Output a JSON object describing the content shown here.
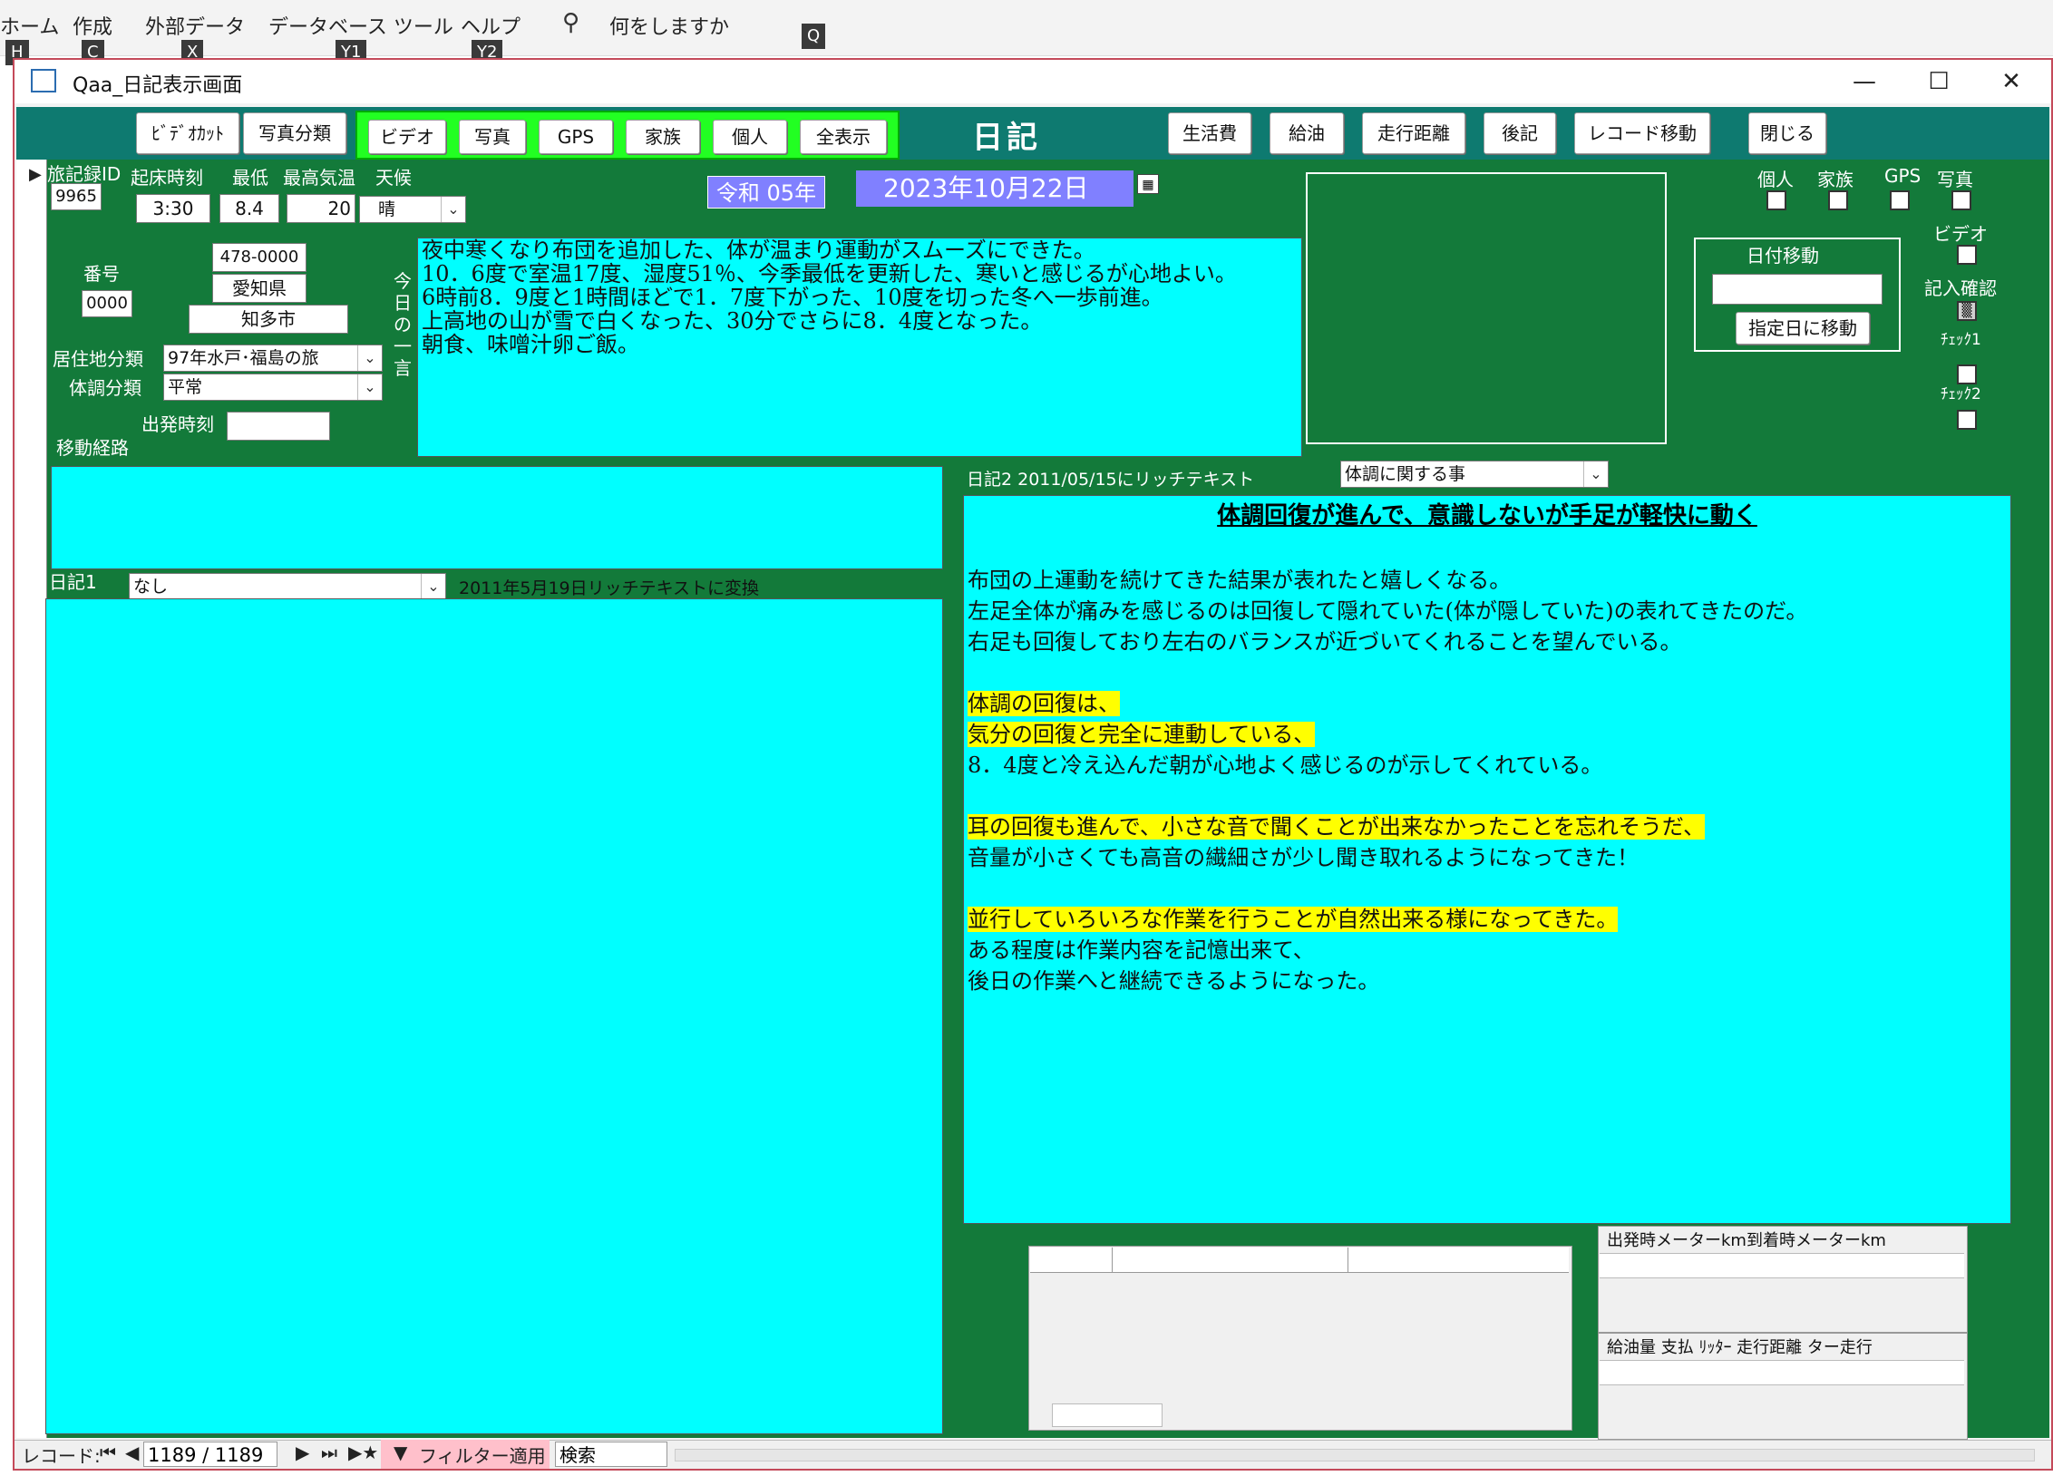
{
  "ribbon": {
    "tabs": [
      "ホーム",
      "作成",
      "外部データ",
      "データベース ツール",
      "ヘルプ"
    ],
    "search_text": "何をしますか",
    "keytips": [
      "H",
      "C",
      "X",
      "Y1",
      "Y2",
      "Q"
    ]
  },
  "window": {
    "title": "Qaa_日記表示画面",
    "icon": "form-icon"
  },
  "header": {
    "left_buttons": [
      "ﾋﾞﾃﾞｵｶｯﾄ",
      "写真分類"
    ],
    "filter_buttons": [
      "ビデオ",
      "写真",
      "GPS",
      "家族",
      "個人",
      "全表示"
    ],
    "title": "日記",
    "right_buttons": [
      "生活費",
      "給油",
      "走行距離",
      "後記",
      "レコード移動",
      "閉じる"
    ]
  },
  "record": {
    "id_label": "旅記録ID",
    "id_value": "9965",
    "wake_label": "起床時刻",
    "wake_value": "3:30",
    "min_label": "最低",
    "min_value": "8.4",
    "max_label": "最高気温",
    "max_value": "20",
    "weather_label": "天候",
    "weather_value": "晴",
    "era_year": "令和 05年",
    "date": "2023年10月22日",
    "number_label": "番号",
    "number_value": "0000",
    "postal": "478-0000",
    "prefecture": "愛知県",
    "city": "知多市",
    "residence_label": "居住地分類",
    "residence_value": "97年水戸･福島の旅",
    "condition_label": "体調分類",
    "condition_value": "平常",
    "departure_label": "出発時刻",
    "departure_value": "",
    "route_label": "移動経路",
    "todays_word_label": "今日の一言",
    "todays_word_lines": [
      "夜中寒くなり布団を追加した、体が温まり運動がスムーズにできた。",
      "10．6度で室温17度、湿度51％、今季最低を更新した、寒いと感じるが心地よい。",
      "6時前8．9度と1時間ほどで1．7度下がった、10度を切った冬へ一歩前進。",
      "上高地の山が雪で白くなった、30分でさらに8．4度となった。",
      "朝食、味噌汁卵ご飯。"
    ]
  },
  "right_panel": {
    "check_labels": [
      "個人",
      "家族",
      "GPS",
      "写真"
    ],
    "video_label": "ビデオ",
    "entry_confirm_label": "記入確認",
    "check1_label": "ﾁｪｯｸ1",
    "check2_label": "ﾁｪｯｸ2",
    "date_move_label": "日付移動",
    "date_move_value": "",
    "go_button": "指定日に移動"
  },
  "diary1": {
    "label": "日記1",
    "combo_value": "なし",
    "note": "2011年5月19日リッチテキストに変換"
  },
  "diary2": {
    "label": "日記2  2011/05/15にリッチテキスト",
    "combo_value": "体調に関する事",
    "heading": "体調回復が進んで、意識しないが手足が軽快に動く",
    "lines": [
      {
        "text": "",
        "hl": false
      },
      {
        "text": "布団の上運動を続けてきた結果が表れたと嬉しくなる。",
        "hl": false
      },
      {
        "text": "左足全体が痛みを感じるのは回復して隠れていた(体が隠していた)の表れてきたのだ。",
        "hl": false
      },
      {
        "text": "右足も回復しており左右のバランスが近づいてくれることを望んでいる。",
        "hl": false
      },
      {
        "text": "",
        "hl": false
      },
      {
        "text": "体調の回復は、",
        "hl": true
      },
      {
        "text": "気分の回復と完全に連動している、",
        "hl": true
      },
      {
        "text": "8．4度と冷え込んだ朝が心地よく感じるのが示してくれている。",
        "hl": false
      },
      {
        "text": "",
        "hl": false
      },
      {
        "text": "耳の回復も進んで、小さな音で聞くことが出来なかったことを忘れそうだ、",
        "hl": true
      },
      {
        "text": "音量が小さくても高音の繊細さが少し聞き取れるようになってきた！",
        "hl": false
      },
      {
        "text": "",
        "hl": false
      },
      {
        "text": "並行していろいろな作業を行うことが自然出来る様になってきた。",
        "hl": true
      },
      {
        "text": "ある程度は作業内容を記憶出来て、",
        "hl": false
      },
      {
        "text": "後日の作業へと継続できるようになった。",
        "hl": false
      }
    ]
  },
  "subforms": {
    "meter_header": "出発時メーターkm到着時メーターkm",
    "fuel_header": "給油量  支払      ﾘｯﾀｰ   走行距離  ター走行"
  },
  "navbar": {
    "record_label": "レコード:",
    "position": "1189 / 1189",
    "filter_label": "フィルター適用",
    "search_label": "検索"
  }
}
